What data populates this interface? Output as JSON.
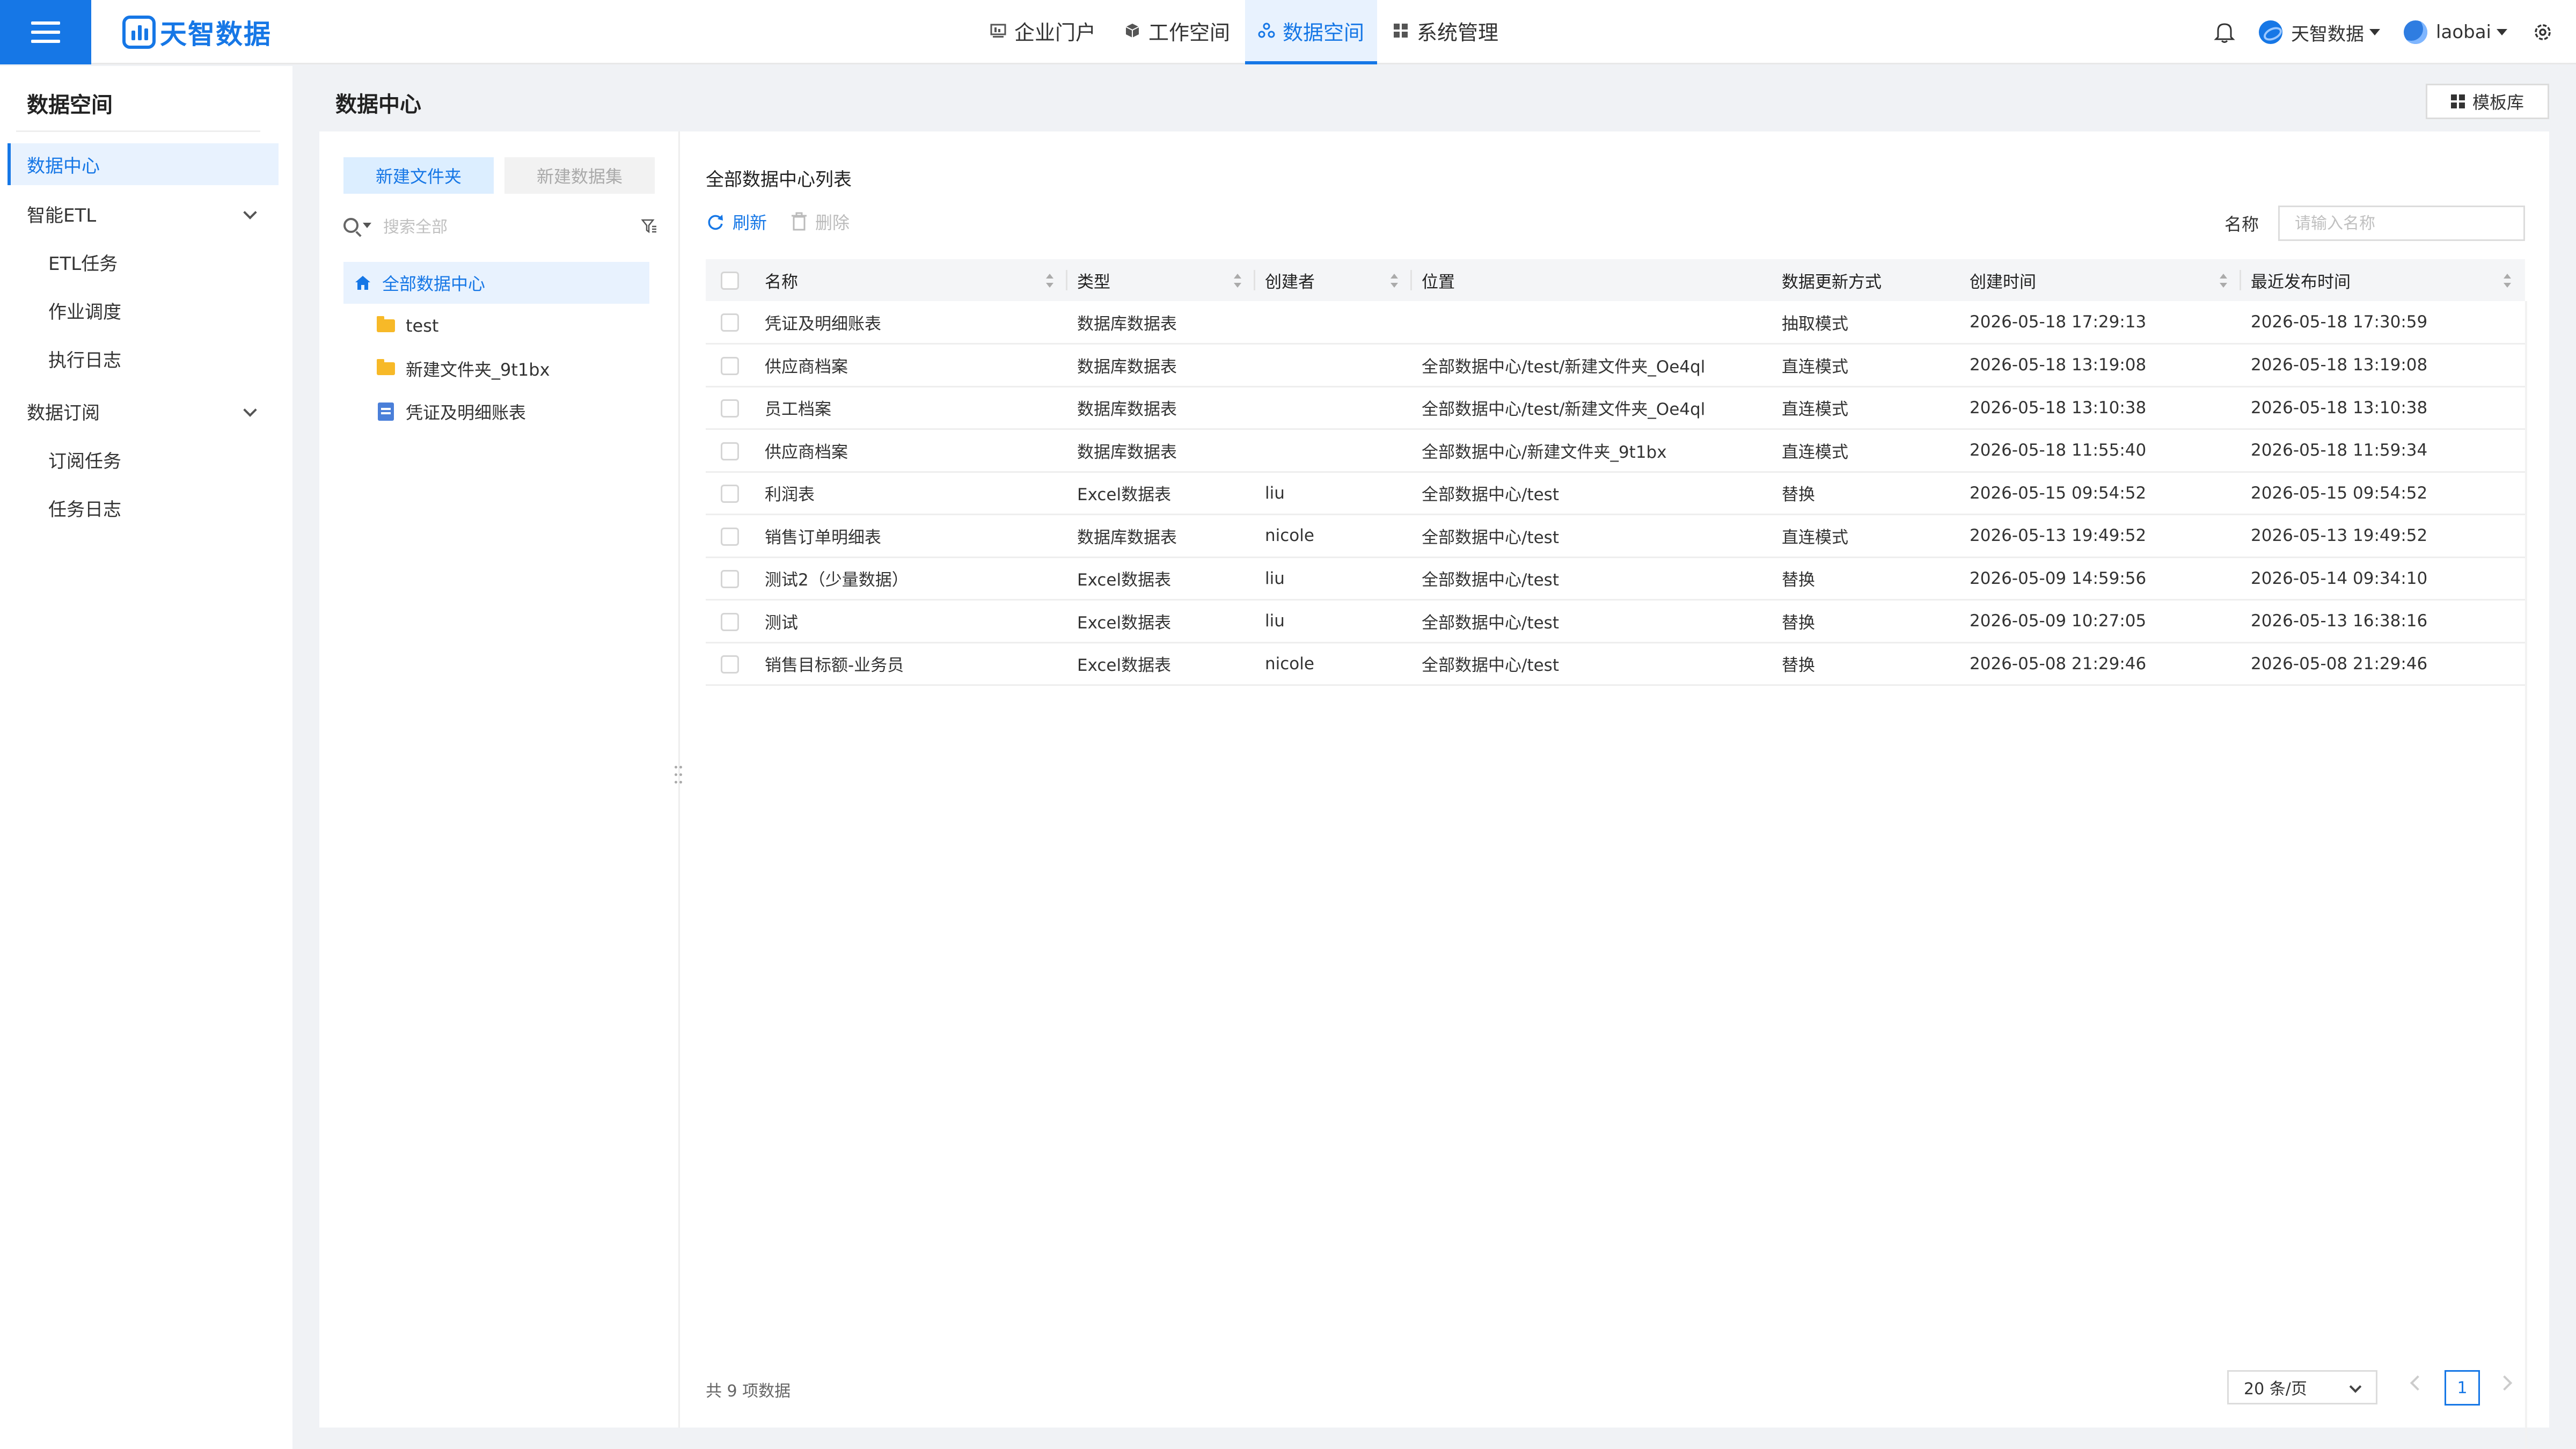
{
  "app": {
    "logo_text": "天智数据",
    "nav": [
      {
        "label": "企业门户",
        "icon": "portal-icon"
      },
      {
        "label": "工作空间",
        "icon": "cube-icon"
      },
      {
        "label": "数据空间",
        "icon": "data-space-icon",
        "active": true
      },
      {
        "label": "系统管理",
        "icon": "grid-icon"
      }
    ],
    "org_name": "天智数据",
    "user_name": "laobai"
  },
  "sidebar": {
    "title": "数据空间",
    "items": [
      {
        "label": "数据中心",
        "active": true
      },
      {
        "label": "智能ETL",
        "group": true
      },
      {
        "label": "ETL任务",
        "sub": true
      },
      {
        "label": "作业调度",
        "sub": true
      },
      {
        "label": "执行日志",
        "sub": true
      },
      {
        "label": "数据订阅",
        "group": true
      },
      {
        "label": "订阅任务",
        "sub": true
      },
      {
        "label": "任务日志",
        "sub": true
      }
    ]
  },
  "page": {
    "title": "数据中心",
    "template_button": "模板库"
  },
  "tree": {
    "new_folder": "新建文件夹",
    "new_dataset": "新建数据集",
    "search_placeholder": "搜索全部",
    "nodes": [
      {
        "label": "全部数据中心",
        "type": "home"
      },
      {
        "label": "test",
        "type": "folder"
      },
      {
        "label": "新建文件夹_9t1bx",
        "type": "folder"
      },
      {
        "label": "凭证及明细账表",
        "type": "table"
      }
    ]
  },
  "list": {
    "title": "全部数据中心列表",
    "refresh": "刷新",
    "delete": "删除",
    "name_label": "名称",
    "name_placeholder": "请输入名称",
    "columns": [
      "名称",
      "类型",
      "创建者",
      "位置",
      "数据更新方式",
      "创建时间",
      "最近发布时间"
    ],
    "rows": [
      [
        "凭证及明细账表",
        "数据库数据表",
        "",
        "",
        "抽取模式",
        "2026-05-18 17:29:13",
        "2026-05-18 17:30:59"
      ],
      [
        "供应商档案",
        "数据库数据表",
        "",
        "全部数据中心/test/新建文件夹_Oe4ql",
        "直连模式",
        "2026-05-18 13:19:08",
        "2026-05-18 13:19:08"
      ],
      [
        "员工档案",
        "数据库数据表",
        "",
        "全部数据中心/test/新建文件夹_Oe4ql",
        "直连模式",
        "2026-05-18 13:10:38",
        "2026-05-18 13:10:38"
      ],
      [
        "供应商档案",
        "数据库数据表",
        "",
        "全部数据中心/新建文件夹_9t1bx",
        "直连模式",
        "2026-05-18 11:55:40",
        "2026-05-18 11:59:34"
      ],
      [
        "利润表",
        "Excel数据表",
        "liu",
        "全部数据中心/test",
        "替换",
        "2026-05-15 09:54:52",
        "2026-05-15 09:54:52"
      ],
      [
        "销售订单明细表",
        "数据库数据表",
        "nicole",
        "全部数据中心/test",
        "直连模式",
        "2026-05-13 19:49:52",
        "2026-05-13 19:49:52"
      ],
      [
        "测试2（少量数据）",
        "Excel数据表",
        "liu",
        "全部数据中心/test",
        "替换",
        "2026-05-09 14:59:56",
        "2026-05-14 09:34:10"
      ],
      [
        "测试",
        "Excel数据表",
        "liu",
        "全部数据中心/test",
        "替换",
        "2026-05-09 10:27:05",
        "2026-05-13 16:38:16"
      ],
      [
        "销售目标额-业务员",
        "Excel数据表",
        "nicole",
        "全部数据中心/test",
        "替换",
        "2026-05-08 21:29:46",
        "2026-05-08 21:29:46"
      ]
    ],
    "total_text": "共 9 项数据",
    "page_size": "20 条/页",
    "current_page": "1"
  },
  "colors": {
    "accent": "#1677e6",
    "folder": "#f7b928"
  }
}
